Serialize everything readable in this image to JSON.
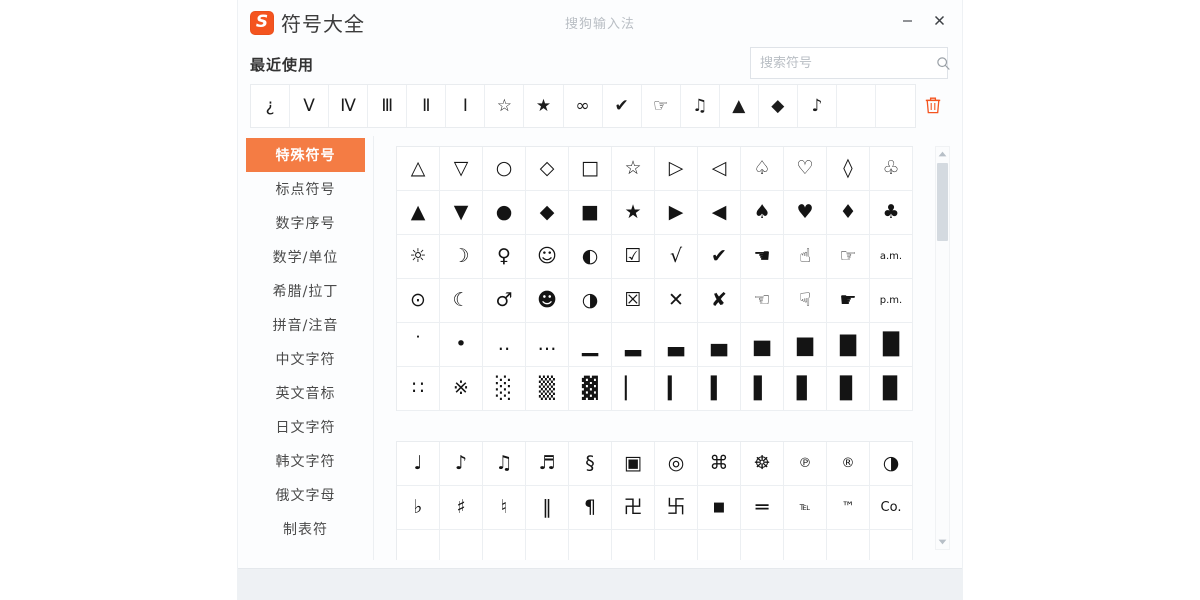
{
  "window": {
    "app_title": "符号大全",
    "logo_letter": "S",
    "center_title": "搜狗输入法",
    "minimize_label": "—",
    "close_label": "✕"
  },
  "recent": {
    "label": "最近使用",
    "delete_tooltip": "清空",
    "symbols": [
      "¿",
      "Ⅴ",
      "Ⅳ",
      "Ⅲ",
      "Ⅱ",
      "Ⅰ",
      "☆",
      "★",
      "∞",
      "✔",
      "☞",
      "♫",
      "▲",
      "◆",
      "♪",
      "",
      ""
    ]
  },
  "search": {
    "placeholder": "搜索符号",
    "value": "",
    "icon": "search-icon"
  },
  "sidebar": {
    "items": [
      {
        "label": "特殊符号",
        "active": true
      },
      {
        "label": "标点符号",
        "active": false
      },
      {
        "label": "数字序号",
        "active": false
      },
      {
        "label": "数学/单位",
        "active": false
      },
      {
        "label": "希腊/拉丁",
        "active": false
      },
      {
        "label": "拼音/注音",
        "active": false
      },
      {
        "label": "中文字符",
        "active": false
      },
      {
        "label": "英文音标",
        "active": false
      },
      {
        "label": "日文字符",
        "active": false
      },
      {
        "label": "韩文字符",
        "active": false
      },
      {
        "label": "俄文字母",
        "active": false
      },
      {
        "label": "制表符",
        "active": false
      }
    ]
  },
  "panel": {
    "groups": [
      {
        "name": "shapes-and-marks",
        "rows": [
          {
            "cells": [
              {
                "ch": "△"
              },
              {
                "ch": "▽"
              },
              {
                "ch": "○"
              },
              {
                "ch": "◇"
              },
              {
                "ch": "□"
              },
              {
                "ch": "☆"
              },
              {
                "ch": "▷"
              },
              {
                "ch": "◁"
              },
              {
                "ch": "♤"
              },
              {
                "ch": "♡"
              },
              {
                "ch": "◊"
              },
              {
                "ch": "♧"
              }
            ]
          },
          {
            "cells": [
              {
                "ch": "▲"
              },
              {
                "ch": "▼"
              },
              {
                "ch": "●"
              },
              {
                "ch": "◆"
              },
              {
                "ch": "■"
              },
              {
                "ch": "★"
              },
              {
                "ch": "▶"
              },
              {
                "ch": "◀"
              },
              {
                "ch": "♠"
              },
              {
                "ch": "♥"
              },
              {
                "ch": "♦"
              },
              {
                "ch": "♣"
              }
            ]
          },
          {
            "cells": [
              {
                "ch": "☼"
              },
              {
                "ch": "☽"
              },
              {
                "ch": "♀"
              },
              {
                "ch": "☺"
              },
              {
                "ch": "◐"
              },
              {
                "ch": "☑"
              },
              {
                "ch": "√"
              },
              {
                "ch": "✔"
              },
              {
                "ch": "☚"
              },
              {
                "ch": "☝"
              },
              {
                "ch": "☞"
              },
              {
                "ch": "a.m.",
                "size": "xs"
              }
            ]
          },
          {
            "cells": [
              {
                "ch": "⊙"
              },
              {
                "ch": "☾"
              },
              {
                "ch": "♂"
              },
              {
                "ch": "☻"
              },
              {
                "ch": "◑"
              },
              {
                "ch": "☒"
              },
              {
                "ch": "✕"
              },
              {
                "ch": "✘"
              },
              {
                "ch": "☜"
              },
              {
                "ch": "☟"
              },
              {
                "ch": "☛"
              },
              {
                "ch": "p.m.",
                "size": "xs"
              }
            ]
          },
          {
            "cells": [
              {
                "ch": "˙"
              },
              {
                "ch": "•"
              },
              {
                "ch": "‥"
              },
              {
                "ch": "…"
              },
              {
                "ch": "▁",
                "size": "blk"
              },
              {
                "ch": "▂",
                "size": "blk"
              },
              {
                "ch": "▃",
                "size": "blk"
              },
              {
                "ch": "▄",
                "size": "blk"
              },
              {
                "ch": "▅",
                "size": "blk"
              },
              {
                "ch": "▆",
                "size": "blk"
              },
              {
                "ch": "▇",
                "size": "blk"
              },
              {
                "ch": "█",
                "size": "blk"
              }
            ]
          },
          {
            "cells": [
              {
                "ch": "∷"
              },
              {
                "ch": "※"
              },
              {
                "ch": "░",
                "size": "blk"
              },
              {
                "ch": "▒",
                "size": "blk"
              },
              {
                "ch": "▓",
                "size": "blk"
              },
              {
                "ch": "▏",
                "size": "blk"
              },
              {
                "ch": "▎",
                "size": "blk"
              },
              {
                "ch": "▍",
                "size": "blk"
              },
              {
                "ch": "▌",
                "size": "blk"
              },
              {
                "ch": "▋",
                "size": "blk"
              },
              {
                "ch": "▊",
                "size": "blk"
              },
              {
                "ch": "▉",
                "size": "blk"
              }
            ]
          }
        ]
      },
      {
        "name": "music-and-signs",
        "rows": [
          {
            "cells": [
              {
                "ch": "♩"
              },
              {
                "ch": "♪"
              },
              {
                "ch": "♫"
              },
              {
                "ch": "♬"
              },
              {
                "ch": "§"
              },
              {
                "ch": "▣"
              },
              {
                "ch": "◎"
              },
              {
                "ch": "⌘"
              },
              {
                "ch": "☸"
              },
              {
                "ch": "℗",
                "size": "sm"
              },
              {
                "ch": "®",
                "size": "sm"
              },
              {
                "ch": "◑"
              }
            ]
          },
          {
            "cells": [
              {
                "ch": "♭"
              },
              {
                "ch": "♯"
              },
              {
                "ch": "♮"
              },
              {
                "ch": "‖"
              },
              {
                "ch": "¶"
              },
              {
                "ch": "卍"
              },
              {
                "ch": "卐"
              },
              {
                "ch": "■",
                "size": "sm"
              },
              {
                "ch": "═",
                "size": "blk"
              },
              {
                "ch": "℡",
                "size": "xs"
              },
              {
                "ch": "™",
                "size": "sm"
              },
              {
                "ch": "Co.",
                "size": "sm"
              }
            ]
          },
          {
            "cells": [
              {
                "ch": ""
              },
              {
                "ch": ""
              },
              {
                "ch": ""
              },
              {
                "ch": ""
              },
              {
                "ch": ""
              },
              {
                "ch": ""
              },
              {
                "ch": ""
              },
              {
                "ch": ""
              },
              {
                "ch": ""
              },
              {
                "ch": ""
              },
              {
                "ch": ""
              },
              {
                "ch": ""
              }
            ]
          }
        ]
      }
    ]
  },
  "scrollbar": {
    "up_label": "▲",
    "down_label": "▼"
  },
  "colors": {
    "accent": "#f47c44",
    "logo": "#f4541f",
    "trash": "#f4541f",
    "footer": "#eef1f4"
  }
}
